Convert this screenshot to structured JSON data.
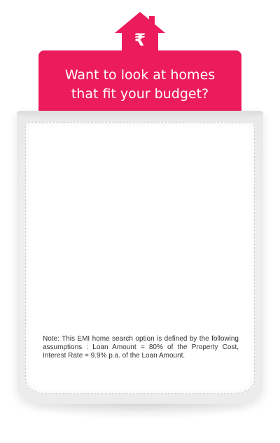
{
  "header": {
    "title_line1": "Want to look at homes",
    "title_line2": "that fit your budget?",
    "currency_symbol": "₹",
    "accent_color": "#ec1b5b",
    "icon": "house-rupee-icon"
  },
  "pocket": {
    "note": "Note: This EMI home search option is defined by the following assumptions : Loan Amount = 80% of the Property Cost, Interest Rate = 9.9% p.a. of the Loan Amount."
  }
}
